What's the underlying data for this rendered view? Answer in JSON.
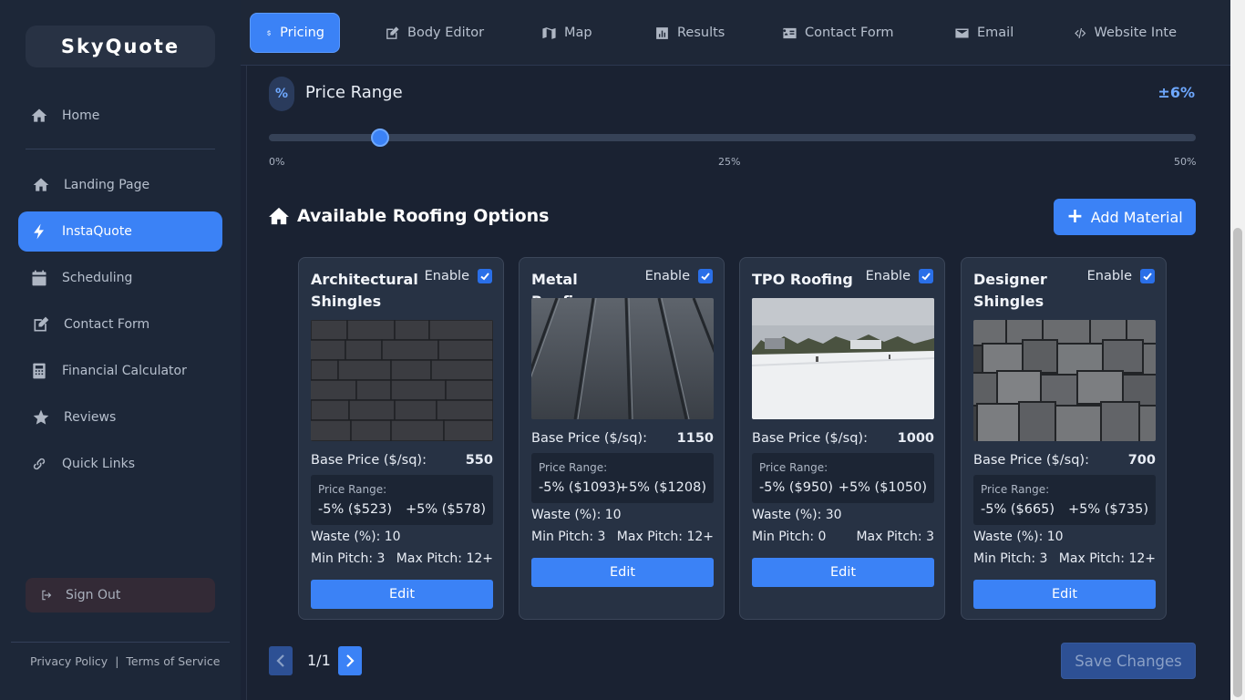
{
  "app": {
    "name": "SkyQuote"
  },
  "sidebar": {
    "items": [
      {
        "label": "Home",
        "icon": "home-icon"
      },
      {
        "label": "Landing Page",
        "icon": "home-icon"
      },
      {
        "label": "InstaQuote",
        "icon": "bolt-icon",
        "active": true
      },
      {
        "label": "Scheduling",
        "icon": "calendar-icon"
      },
      {
        "label": "Contact Form",
        "icon": "edit-icon"
      },
      {
        "label": "Financial Calculator",
        "icon": "calculator-icon"
      },
      {
        "label": "Reviews",
        "icon": "star-icon"
      },
      {
        "label": "Quick Links",
        "icon": "link-icon"
      }
    ],
    "signout": "Sign Out",
    "footer": {
      "privacy": "Privacy Policy",
      "divider": "|",
      "terms": "Terms of Service"
    }
  },
  "tabs": [
    {
      "label": "Pricing",
      "icon": "dollar-icon",
      "active": true
    },
    {
      "label": "Body Editor",
      "icon": "edit-icon"
    },
    {
      "label": "Map",
      "icon": "map-icon"
    },
    {
      "label": "Results",
      "icon": "chart-icon"
    },
    {
      "label": "Contact Form",
      "icon": "contact-card-icon"
    },
    {
      "label": "Email",
      "icon": "envelope-icon"
    },
    {
      "label": "Website Inte",
      "icon": "code-icon"
    }
  ],
  "price_range": {
    "icon_glyph": "%",
    "title": "Price Range",
    "value": "±6%",
    "slider_value": 6,
    "slider_min": 0,
    "slider_max": 50,
    "ticks": [
      "0%",
      "25%",
      "50%"
    ]
  },
  "options": {
    "title": "Available Roofing Options",
    "add_label": "Add Material",
    "add_glyph": "+",
    "cards": [
      {
        "name": "Architectural Shingles",
        "enable": "Enable",
        "base_label": "Base Price ($/sq):",
        "base": "550",
        "range_label": "Price Range:",
        "low": "-5% ($523)",
        "high": "+5% ($578)",
        "waste": "Waste (%): 10",
        "min_pitch": "Min Pitch: 3",
        "max_pitch": "Max Pitch: 12+",
        "edit": "Edit"
      },
      {
        "name": "Metal Roofing",
        "enable": "Enable",
        "base_label": "Base Price ($/sq):",
        "base": "1150",
        "range_label": "Price Range:",
        "low": "-5% ($1093)",
        "high": "+5% ($1208)",
        "waste": "Waste (%): 10",
        "min_pitch": "Min Pitch: 3",
        "max_pitch": "Max Pitch: 12+",
        "edit": "Edit"
      },
      {
        "name": "TPO Roofing",
        "enable": "Enable",
        "base_label": "Base Price ($/sq):",
        "base": "1000",
        "range_label": "Price Range:",
        "low": "-5% ($950)",
        "high": "+5% ($1050)",
        "waste": "Waste (%): 30",
        "min_pitch": "Min Pitch: 0",
        "max_pitch": "Max Pitch: 3",
        "edit": "Edit"
      },
      {
        "name": "Designer Shingles",
        "enable": "Enable",
        "base_label": "Base Price ($/sq):",
        "base": "700",
        "range_label": "Price Range:",
        "low": "-5% ($665)",
        "high": "+5% ($735)",
        "waste": "Waste (%): 10",
        "min_pitch": "Min Pitch: 3",
        "max_pitch": "Max Pitch: 12+",
        "edit": "Edit"
      }
    ]
  },
  "pagination": {
    "text": "1/1"
  },
  "save_label": "Save Changes",
  "colors": {
    "accent": "#3b82f6",
    "bg": "#1a2232",
    "sidebar": "#1d2738",
    "card": "#273244"
  }
}
